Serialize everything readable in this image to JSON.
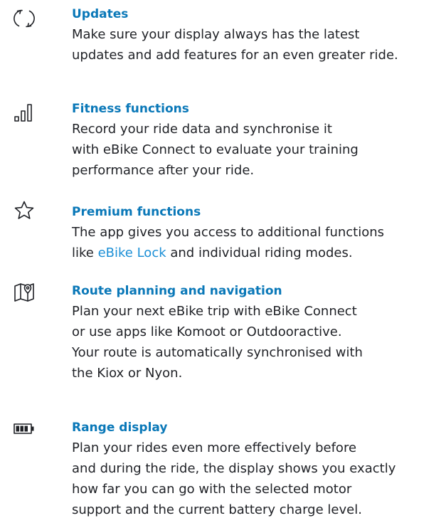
{
  "features": [
    {
      "icon": "refresh-icon",
      "title": "Updates",
      "lines": [
        "Make sure your display always has the latest",
        "updates and add features for an even greater ride."
      ]
    },
    {
      "icon": "signal-bars-icon",
      "title": "Fitness functions",
      "lines": [
        "Record your ride data and synchronise it",
        "with eBike Connect to evaluate your training",
        "performance after your ride."
      ]
    },
    {
      "icon": "star-icon",
      "title": "Premium functions",
      "line1": "The app gives you access to additional functions",
      "line2_prefix": "like ",
      "link_text": "eBike Lock",
      "line2_suffix": " and individual riding modes."
    },
    {
      "icon": "map-pin-icon",
      "title": "Route planning and navigation",
      "lines": [
        "Plan your next eBike trip with eBike Connect",
        "or use apps like Komoot or Outdooractive.",
        "Your route is automatically synchronised with",
        "the Kiox or Nyon."
      ]
    },
    {
      "icon": "battery-icon",
      "title": "Range display",
      "lines": [
        "Plan your rides even more effectively before",
        "and during the ride, the display shows you exactly",
        "how far you can go with the selected motor",
        "support and the current battery charge level."
      ]
    }
  ],
  "colors": {
    "accent": "#0a78b8",
    "link": "#1b8fd6",
    "text": "#1f2126",
    "icon": "#1f2126"
  }
}
